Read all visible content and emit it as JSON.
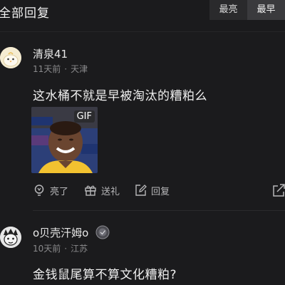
{
  "header": {
    "title": "全部回复",
    "sort_options": [
      "最亮",
      "最早"
    ],
    "sort_selected": "最早"
  },
  "comments": [
    {
      "username": "清泉41",
      "time": "11天前",
      "location": "天津",
      "content": "这水桶不就是早被淘汰的糟粕么",
      "media_badge": "GIF",
      "actions": {
        "like_label": "亮了",
        "gift_label": "送礼",
        "reply_label": "回复"
      }
    },
    {
      "username": "o贝壳汗姆o",
      "time": "10天前",
      "location": "江苏",
      "content": "金钱鼠尾算不算文化糟粕?"
    }
  ],
  "colors": {
    "background": "#1b1b1d",
    "text_primary": "#f0f0f0",
    "text_secondary": "#8a8a8c"
  }
}
